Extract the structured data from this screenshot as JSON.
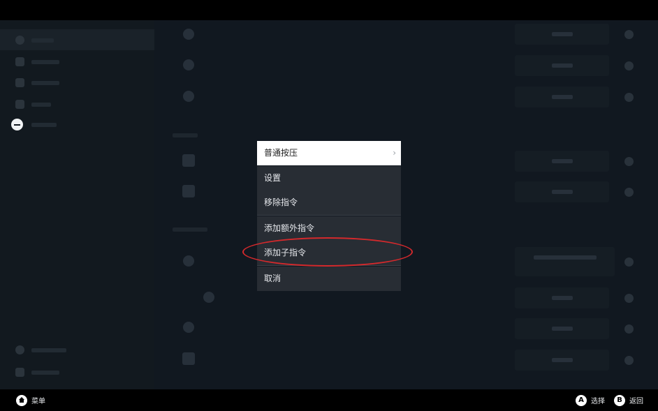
{
  "context_menu": {
    "items": [
      {
        "label": "普通按压",
        "has_submenu": true,
        "active": true
      },
      {
        "label": "设置"
      },
      {
        "label": "移除指令"
      },
      {
        "label": "添加额外指令"
      },
      {
        "label": "添加子指令",
        "highlighted_by_annotation": true
      },
      {
        "label": "取消"
      }
    ],
    "submenu_chevron": "›"
  },
  "annotation": {
    "color": "#d4292c"
  },
  "footer": {
    "menu_label": "菜单",
    "select_button": "A",
    "select_label": "选择",
    "back_button": "B",
    "back_label": "返回"
  },
  "icons": [
    "minus-circle-icon",
    "home-icon",
    "chevron-right-icon"
  ],
  "colors": {
    "menu_bg": "#282d34",
    "menu_active_bg": "#ffffff",
    "background": "#111820"
  }
}
